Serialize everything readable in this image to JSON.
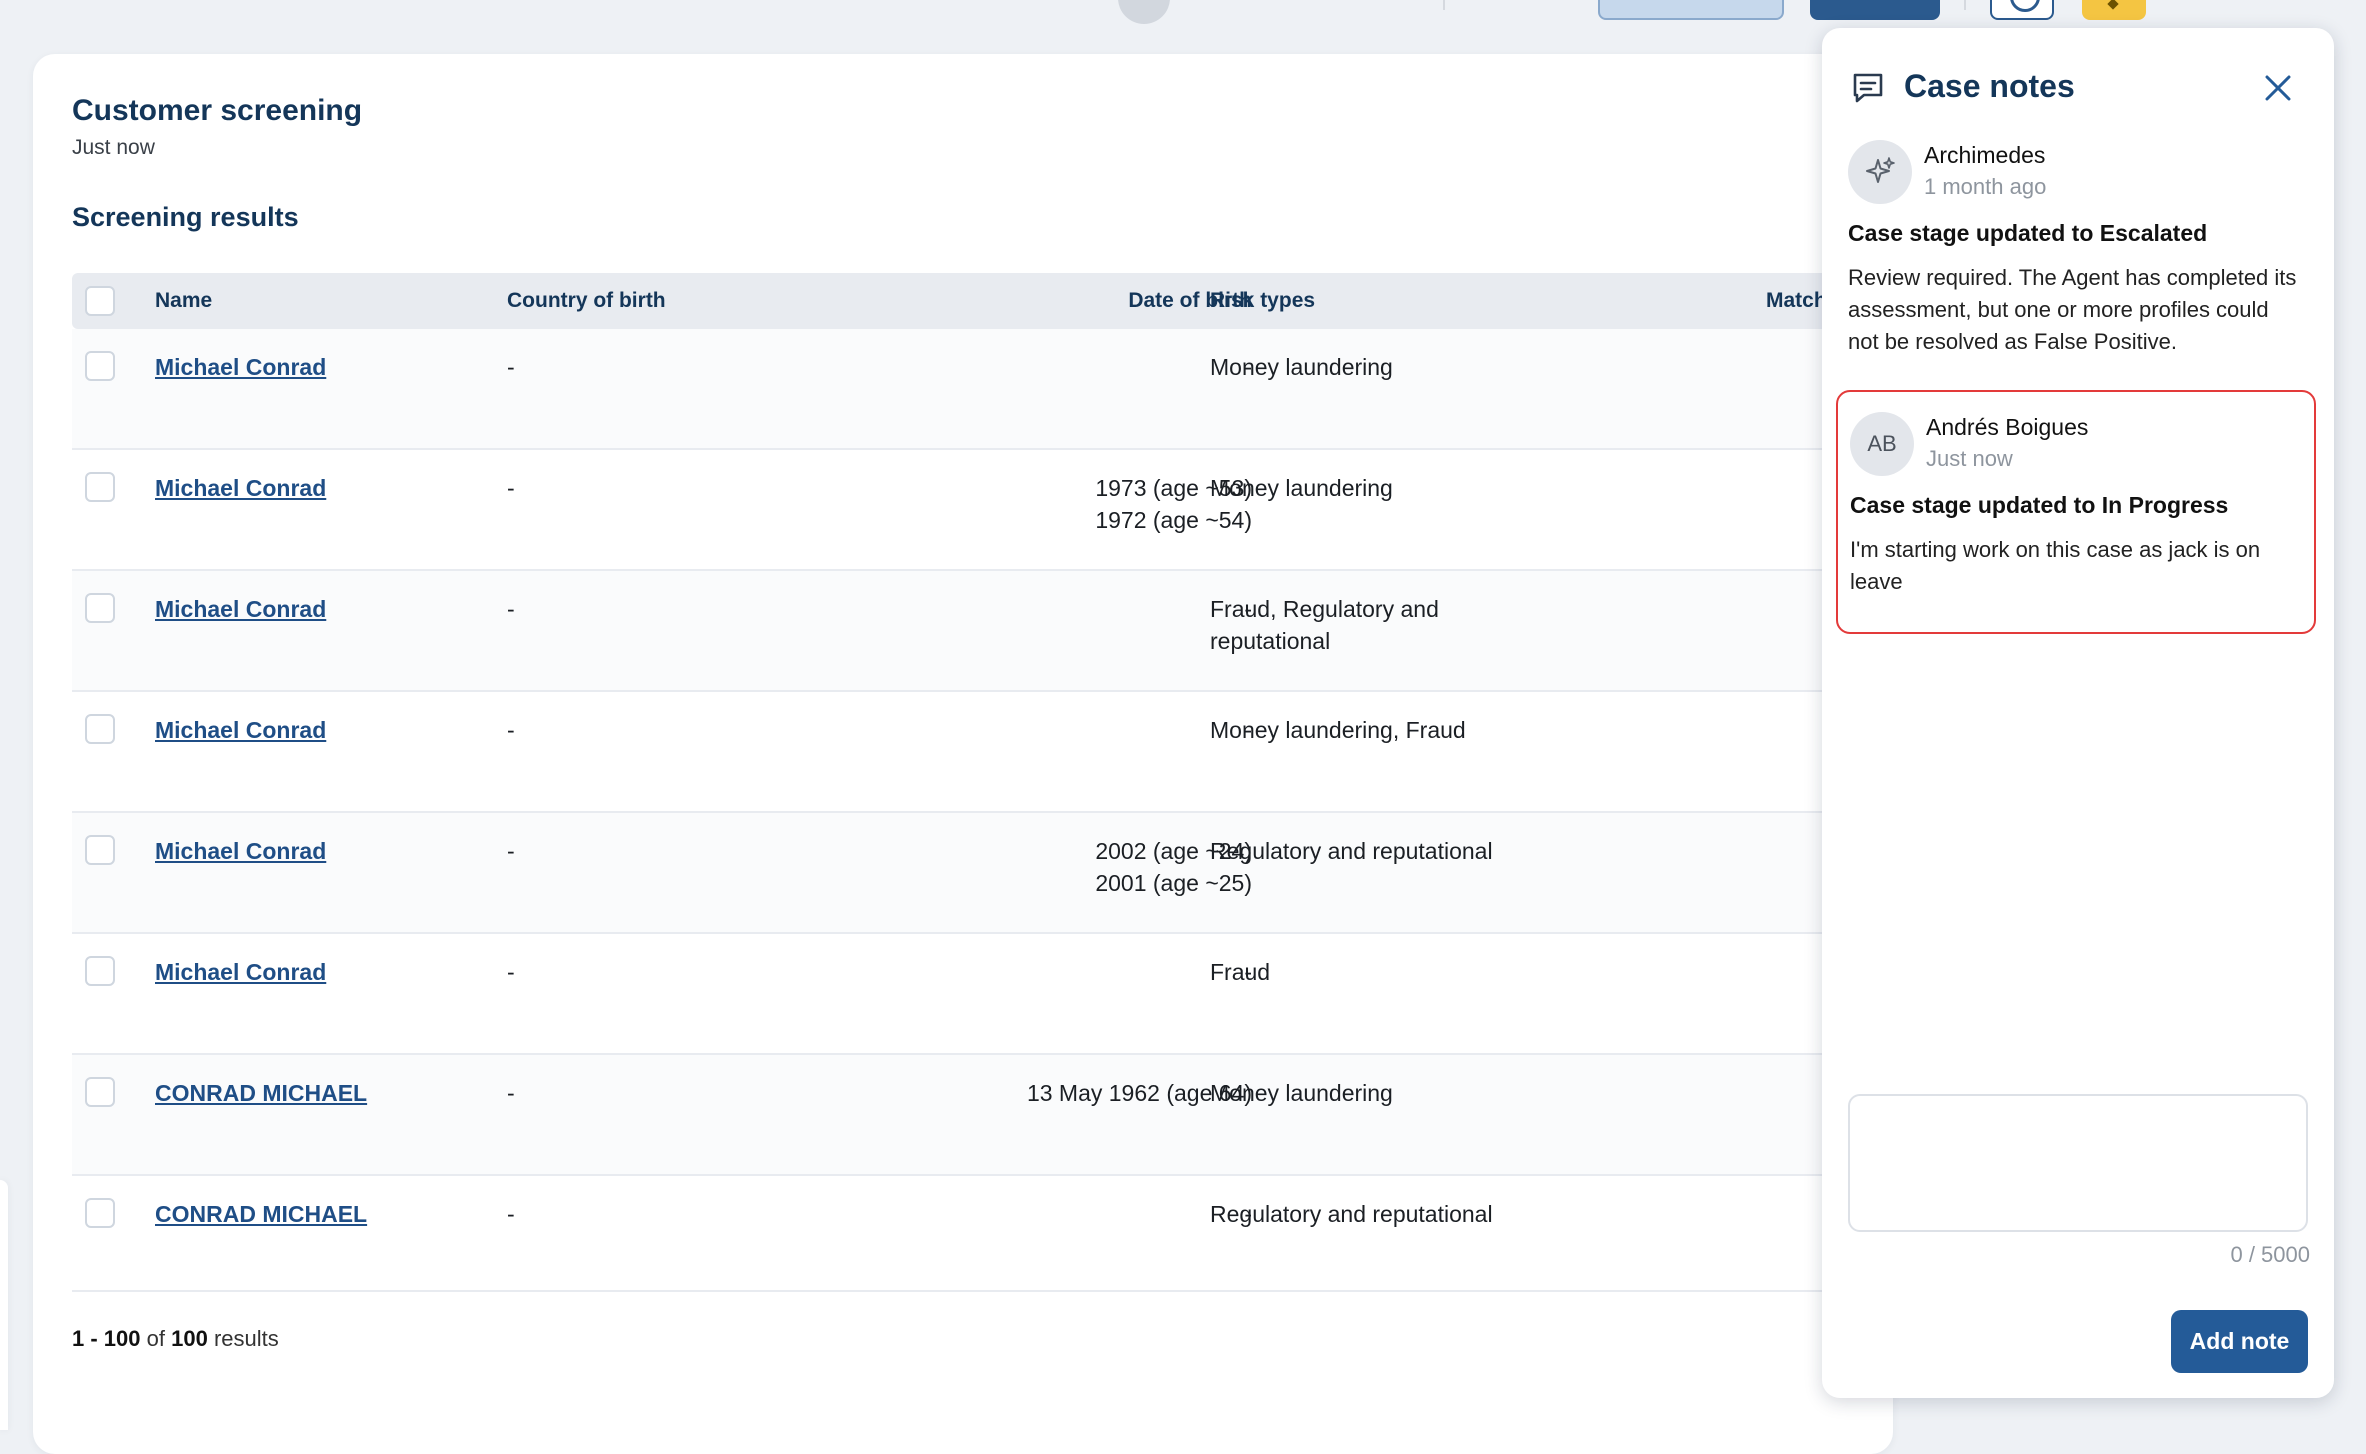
{
  "header": {
    "items": [
      "",
      "",
      ""
    ]
  },
  "screening": {
    "title": "Customer screening",
    "subtitle": "Just now",
    "section_title": "Screening results",
    "columns": [
      "Name",
      "Country of birth",
      "Date of birth",
      "Risk types",
      "Match"
    ],
    "rows": [
      {
        "name": "Michael Conrad",
        "country": "-",
        "dob": "-",
        "risk": "Money laundering"
      },
      {
        "name": "Michael Conrad",
        "country": "-",
        "dob": "1973 (age ~53)\n1972 (age ~54)",
        "risk": "Money laundering"
      },
      {
        "name": "Michael Conrad",
        "country": "-",
        "dob": "-",
        "risk": "Fraud, Regulatory and reputational"
      },
      {
        "name": "Michael Conrad",
        "country": "-",
        "dob": "-",
        "risk": "Money laundering, Fraud"
      },
      {
        "name": "Michael Conrad",
        "country": "-",
        "dob": "2002 (age ~24)\n2001 (age ~25)",
        "risk": "Regulatory and reputational"
      },
      {
        "name": "Michael Conrad",
        "country": "-",
        "dob": "-",
        "risk": "Fraud"
      },
      {
        "name": "CONRAD MICHAEL",
        "country": "-",
        "dob": "13 May 1962 (age 64)",
        "risk": "Money laundering"
      },
      {
        "name": "CONRAD MICHAEL",
        "country": "-",
        "dob": "-",
        "risk": "Regulatory and reputational"
      }
    ],
    "pager": {
      "range": "1 - 100",
      "of": "of",
      "total": "100",
      "suffix": "results"
    }
  },
  "notes_panel": {
    "title": "Case notes",
    "notes": [
      {
        "initials": "",
        "author": "Archimedes",
        "when": "1 month ago",
        "title": "Case stage updated to Escalated",
        "body": "Review required. The Agent has completed its assessment, but one or more profiles could not be resolved as False Positive."
      },
      {
        "initials": "AB",
        "author": "Andrés Boigues",
        "when": "Just now",
        "title": "Case stage updated to In Progress",
        "body": "I'm starting work on this case as jack is on leave"
      }
    ],
    "textarea_value": "",
    "counter": "0 / 5000",
    "add_button": "Add note"
  },
  "colors": {
    "primary": "#245b98",
    "heading": "#143659",
    "highlight_border": "#e33a3a",
    "link": "#1f4e86"
  },
  "icons": [
    "comment-icon",
    "close-icon",
    "sparkle-icon",
    "resize-handle-icon"
  ]
}
